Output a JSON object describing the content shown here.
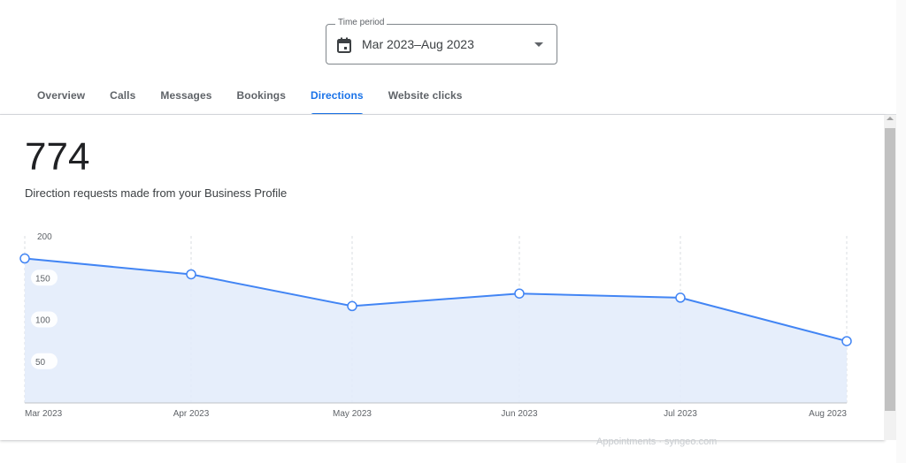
{
  "time_period": {
    "legend": "Time period",
    "value": "Mar 2023–Aug 2023",
    "calendar_icon": "calendar-icon",
    "caret_icon": "dropdown-caret-icon"
  },
  "tabs": [
    {
      "label": "Overview",
      "active": false
    },
    {
      "label": "Calls",
      "active": false
    },
    {
      "label": "Messages",
      "active": false
    },
    {
      "label": "Bookings",
      "active": false
    },
    {
      "label": "Directions",
      "active": true
    },
    {
      "label": "Website clicks",
      "active": false
    }
  ],
  "metric": {
    "value": "774",
    "description": "Direction requests made from your Business Profile"
  },
  "colors": {
    "accent": "#1a73e8",
    "line": "#4285f4",
    "fill": "#e3ecfb"
  },
  "background_hint": "Appointments · syngeo.com",
  "chart_data": {
    "type": "area",
    "categories": [
      "Mar 2023",
      "Apr 2023",
      "May 2023",
      "Jun 2023",
      "Jul 2023",
      "Aug 2023"
    ],
    "values": [
      173,
      154,
      116,
      131,
      126,
      74
    ],
    "y_ticks": [
      50,
      100,
      150,
      200
    ],
    "ylim": [
      0,
      200
    ],
    "grid": "vertical-dashed",
    "title": "",
    "xlabel": "",
    "ylabel": ""
  }
}
